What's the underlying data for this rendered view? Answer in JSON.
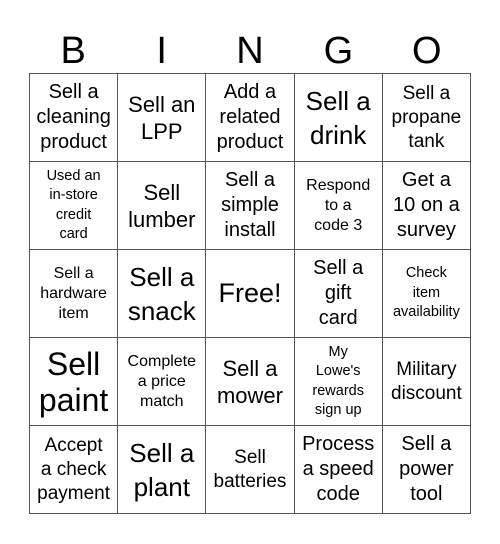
{
  "header": {
    "letters": [
      "B",
      "I",
      "N",
      "G",
      "O"
    ]
  },
  "cells": [
    "Sell a\ncleaning\nproduct",
    "Sell an\nLPP",
    "Add a\nrelated\nproduct",
    "Sell a\ndrink",
    "Sell a\npropane\ntank",
    "Used an\nin-store\ncredit\ncard",
    "Sell\nlumber",
    "Sell a\nsimple\ninstall",
    "Respond\nto a\ncode 3",
    "Get a\n10 on a\nsurvey",
    "Sell a\nhardware\nitem",
    "Sell a\nsnack",
    "Free!",
    "Sell a\ngift\ncard",
    "Check\nitem\navailability",
    "Sell\npaint",
    "Complete\na price\nmatch",
    "Sell a\nmower",
    "My\nLowe's\nrewards\nsign up",
    "Military\ndiscount",
    "Accept\na check\npayment",
    "Sell a\nplant",
    "Sell\nbatteries",
    "Process\na speed\ncode",
    "Sell a\npower\ntool"
  ]
}
